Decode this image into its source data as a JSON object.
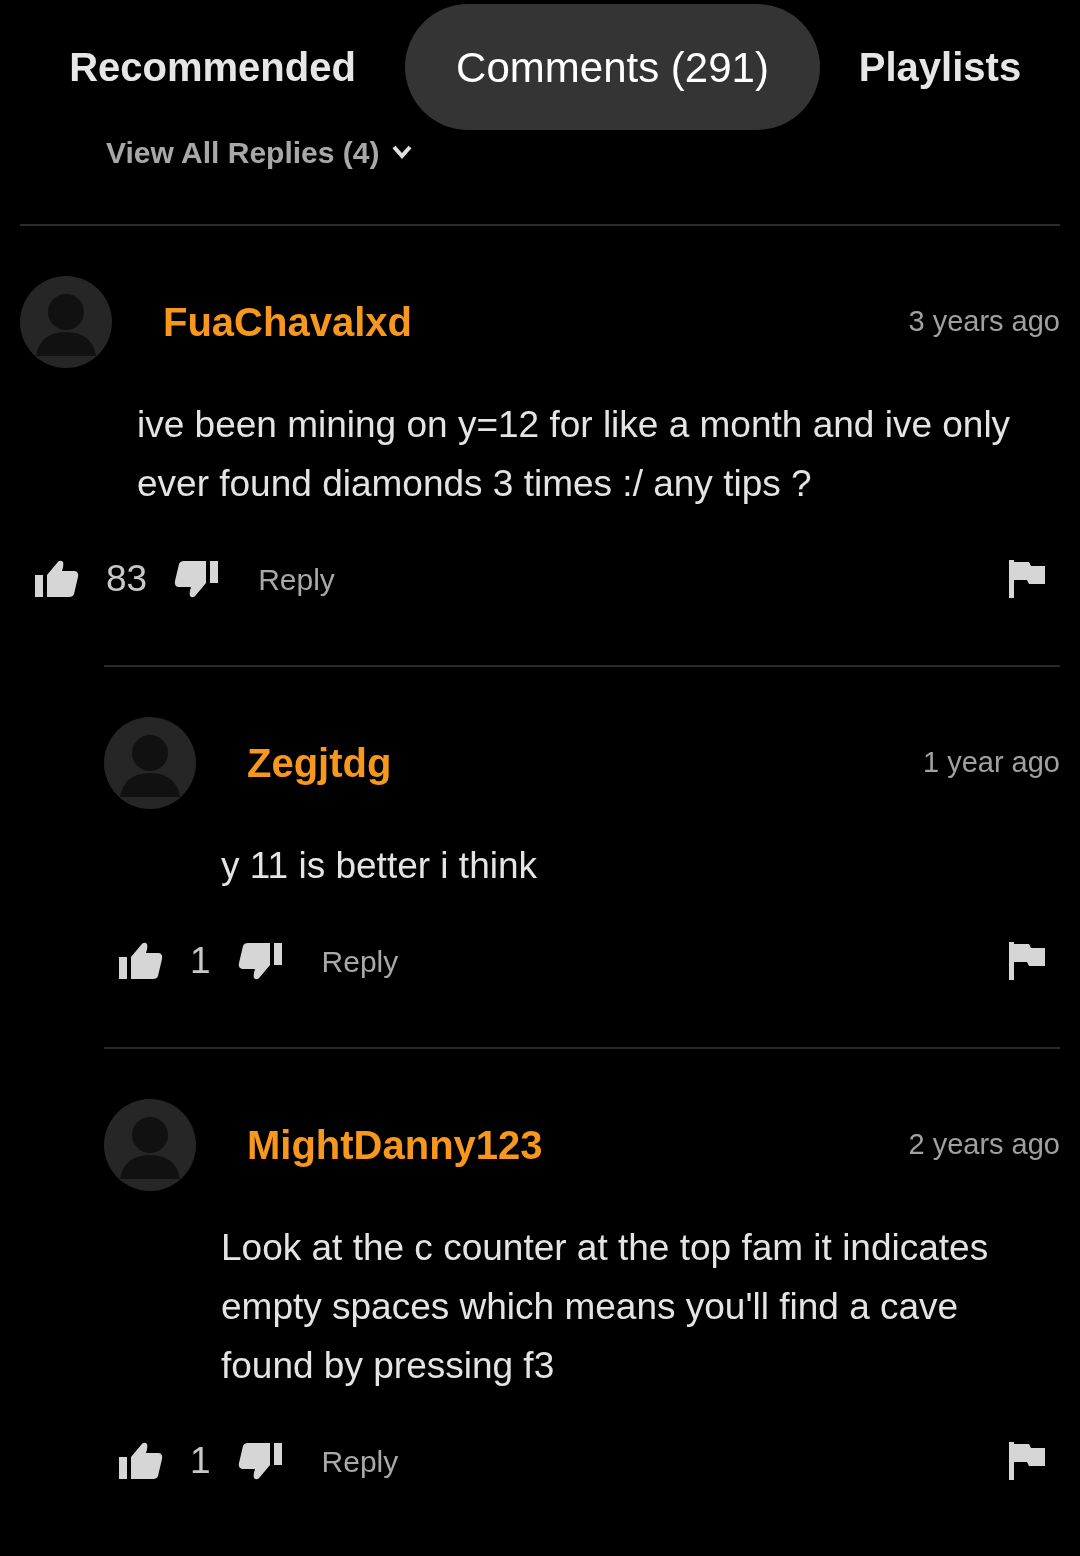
{
  "tabs": [
    {
      "label": "Recommended",
      "selected": false
    },
    {
      "label": "Comments (291)",
      "selected": true
    },
    {
      "label": "Playlists",
      "selected": false
    }
  ],
  "view_replies": "View All Replies (4)",
  "comments": [
    {
      "author": "FuaChavalxd",
      "time": "3 years ago",
      "text": "ive been mining on y=12 for like a month and ive only ever found diamonds 3 times :/ any tips ?",
      "likes": "83",
      "reply": "Reply",
      "children": [
        {
          "author": "Zegjtdg",
          "time": "1 year ago",
          "text": "y 11 is better i think",
          "likes": "1",
          "reply": "Reply"
        },
        {
          "author": "MightDanny123",
          "time": "2 years ago",
          "text": "Look at the c counter at the top fam it indicates empty spaces which means you'll find a cave found by pressing f3",
          "likes": "1",
          "reply": "Reply"
        }
      ]
    }
  ]
}
